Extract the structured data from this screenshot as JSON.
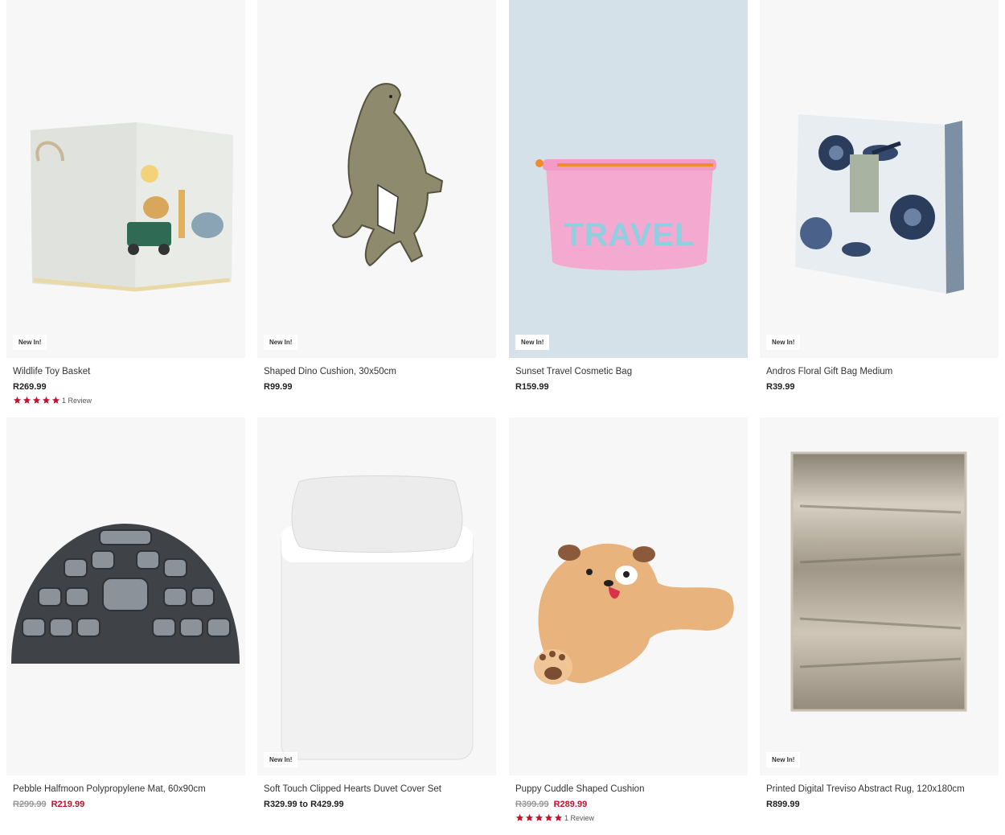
{
  "colors": {
    "sale_price": "#c8102e",
    "star": "#c8102e",
    "tile_bg": "#f7f7f7"
  },
  "products": [
    {
      "name": "Wildlife Toy Basket",
      "badge": "New In!",
      "price": "R269.99",
      "reviews": "1 Review",
      "rating": 5,
      "image_icon": "toy-basket-icon"
    },
    {
      "name": "Shaped Dino Cushion, 30x50cm",
      "badge": "New In!",
      "price": "R99.99",
      "image_icon": "dino-cushion-icon"
    },
    {
      "name": "Sunset Travel Cosmetic Bag",
      "badge": "New In!",
      "price": "R159.99",
      "image_icon": "cosmetic-bag-icon",
      "image_text": "TRAVEL"
    },
    {
      "name": "Andros Floral Gift Bag Medium",
      "badge": "New In!",
      "price": "R39.99",
      "image_icon": "gift-bag-icon"
    },
    {
      "name": "Pebble Halfmoon Polypropylene Mat, 60x90cm",
      "was_price": "R299.99",
      "price": "R219.99",
      "image_icon": "halfmoon-mat-icon"
    },
    {
      "name": "Soft Touch Clipped Hearts Duvet Cover Set",
      "badge": "New In!",
      "price": "R329.99 to R429.99",
      "image_icon": "duvet-set-icon"
    },
    {
      "name": "Puppy Cuddle Shaped Cushion",
      "was_price": "R399.99",
      "price": "R289.99",
      "reviews": "1 Review",
      "rating": 5,
      "image_icon": "puppy-cushion-icon"
    },
    {
      "name": "Printed Digital Treviso Abstract Rug, 120x180cm",
      "badge": "New In!",
      "price": "R899.99",
      "image_icon": "abstract-rug-icon"
    }
  ]
}
